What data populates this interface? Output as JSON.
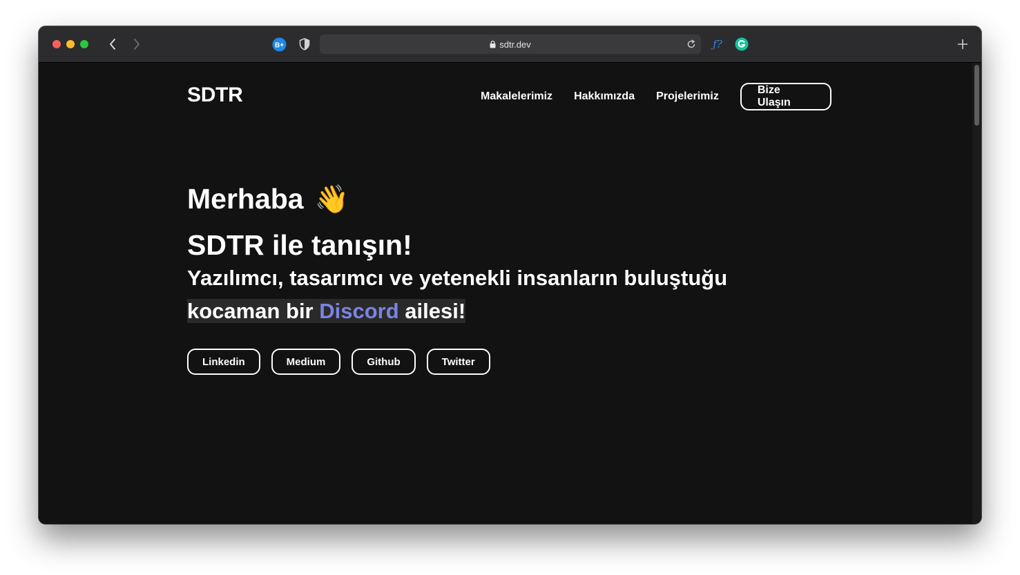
{
  "browser": {
    "url": "sdtr.dev",
    "ext_b_label": "B+",
    "ext_f_label": "ƒ?"
  },
  "site": {
    "logo": "SDTR",
    "nav": [
      "Makalelerimiz",
      "Hakkımızda",
      "Projelerimiz"
    ],
    "contact_button": "Bize Ulaşın"
  },
  "hero": {
    "greeting": "Merhaba",
    "greeting_emoji": "👋",
    "title": "SDTR ile tanışın!",
    "subtitle_part1": "Yazılımcı, tasarımcı ve yetenekli insanların buluştuğu ",
    "subtitle_highlight_pre": "kocaman bir ",
    "subtitle_link": "Discord",
    "subtitle_highlight_post": " ailesi!"
  },
  "socials": [
    "Linkedin",
    "Medium",
    "Github",
    "Twitter"
  ],
  "colors": {
    "background": "#121212",
    "accent": "#7b84e0",
    "toolbar": "#2c2c2e"
  }
}
